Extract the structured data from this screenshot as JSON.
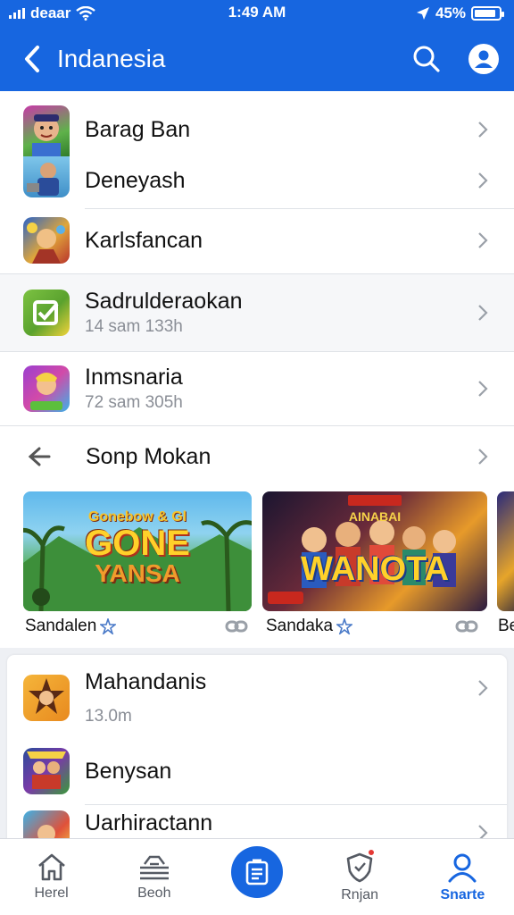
{
  "status_bar": {
    "carrier": "deaar",
    "time": "1:49 AM",
    "battery": "45%",
    "battery_level": 0.9
  },
  "header": {
    "title": "Indanesia",
    "back_icon": "chevron-left-icon",
    "search_icon": "search-icon",
    "profile_icon": "user-icon"
  },
  "list_top": [
    {
      "title": "Barag Ban",
      "icon": "game-character-icon"
    },
    {
      "title": "Deneyash",
      "icon": "game-character-icon"
    },
    {
      "title": "Karlsfancan",
      "icon": "game-art-icon"
    },
    {
      "title": "Sadrulderaokan",
      "subtitle": "14 sam 133h",
      "icon": "green-app-icon"
    },
    {
      "title": "Inmsnaria",
      "subtitle": "72 sam 305h",
      "icon": "game-art-icon"
    }
  ],
  "section": {
    "title": "Sonp Mokan",
    "icon": "back-arrow-icon"
  },
  "banners": [
    {
      "caption": "Sandalen",
      "art_text_top": "Gonebow & Gl",
      "art_text_main": "GONE",
      "art_text_sub": "YANSA"
    },
    {
      "caption": "Sandaka",
      "art_text_top": "AINABAI",
      "art_text_main": "WANOTA",
      "art_text_sub": ""
    },
    {
      "caption": "Be"
    }
  ],
  "list_bottom": [
    {
      "title": "Mahandanis",
      "subtitle": "13.0m",
      "icon": "game-character-icon"
    },
    {
      "title": "Benysan",
      "icon": "game-art-icon"
    },
    {
      "title": "Uarhiractann",
      "icon": "game-art-icon"
    }
  ],
  "bottom_nav": [
    {
      "label": "Herel",
      "icon": "home-icon",
      "active": false
    },
    {
      "label": "Beoh",
      "icon": "inbox-icon",
      "active": false
    },
    {
      "label": "",
      "icon": "list-icon",
      "active": false
    },
    {
      "label": "Rnjan",
      "icon": "shield-icon",
      "active": false
    },
    {
      "label": "Snarte",
      "icon": "user-icon",
      "active": true
    }
  ],
  "colors": {
    "primary": "#1766e0",
    "divider": "#dfe2e7",
    "subtext": "#8a8e96",
    "badge": "#e53935"
  }
}
